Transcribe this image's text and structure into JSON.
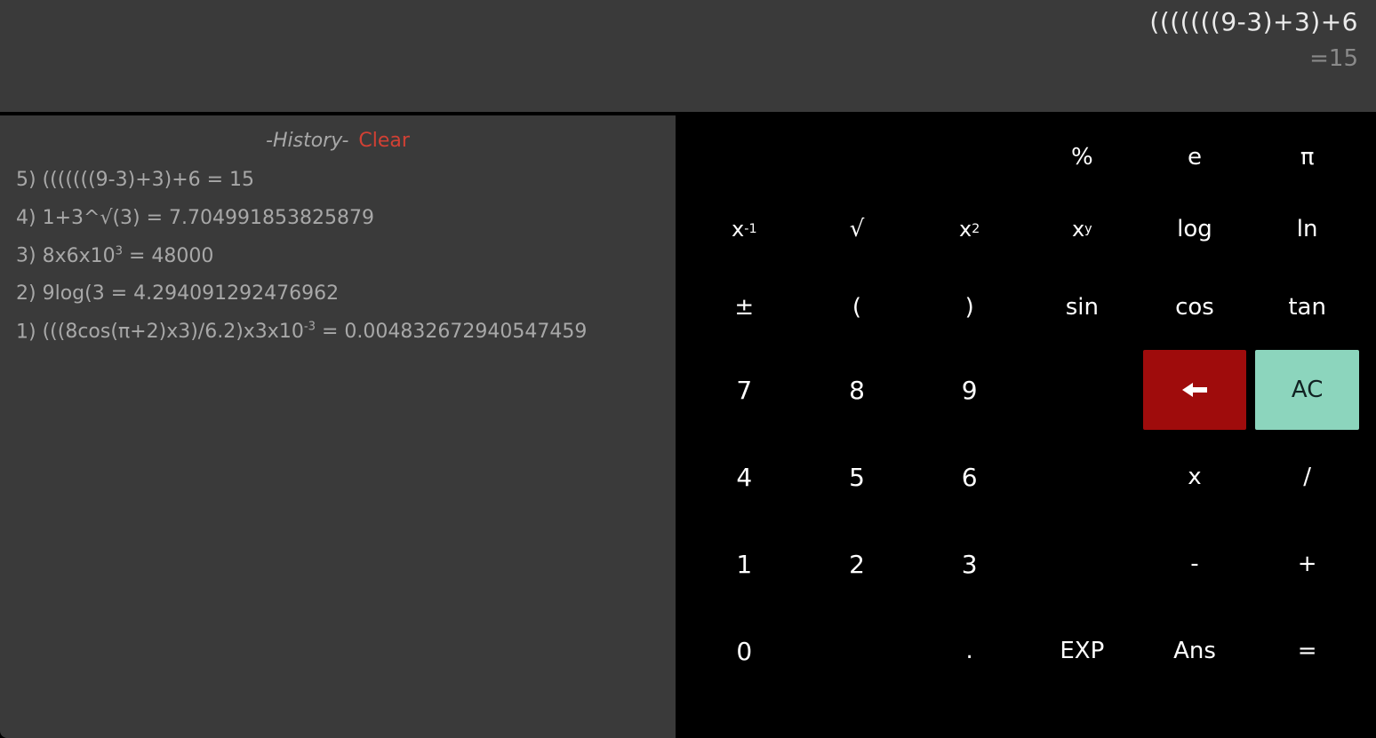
{
  "display": {
    "expression": "(((((((9-3)+3)+6",
    "result": "=15"
  },
  "history": {
    "title": "-History-",
    "clear_label": "Clear",
    "items": [
      {
        "index": "5)",
        "content": "(((((((9-3)+3)+6 = 15"
      },
      {
        "index": "4)",
        "content": "1+3^√(3) = 7.704991853825879"
      },
      {
        "index": "3)",
        "content_html": "8x6x10<sup>3</sup> = 48000"
      },
      {
        "index": "2)",
        "content": "9log(3 = 4.294091292476962"
      },
      {
        "index": "1)",
        "content_html": "(((8cos(π+2)x3)/6.2)x3x10<sup>-3</sup> = 0.004832672940547459"
      }
    ]
  },
  "keys": {
    "percent": "%",
    "e": "e",
    "pi": "π",
    "inverse_html": "x <sup>-1</sup>",
    "sqrt": "√",
    "square_html": "x<sup>2</sup>",
    "power_html": "x<sup>y</sup>",
    "log": "log",
    "ln": "ln",
    "plusminus": "±",
    "lparen": "(",
    "rparen": ")",
    "sin": "sin",
    "cos": "cos",
    "tan": "tan",
    "d7": "7",
    "d8": "8",
    "d9": "9",
    "ac": "AC",
    "d4": "4",
    "d5": "5",
    "d6": "6",
    "multiply": "x",
    "divide": "/",
    "d1": "1",
    "d2": "2",
    "d3": "3",
    "minus": "-",
    "plus": "+",
    "d0": "0",
    "dot": ".",
    "exp": "EXP",
    "ans": "Ans",
    "equals": "="
  }
}
